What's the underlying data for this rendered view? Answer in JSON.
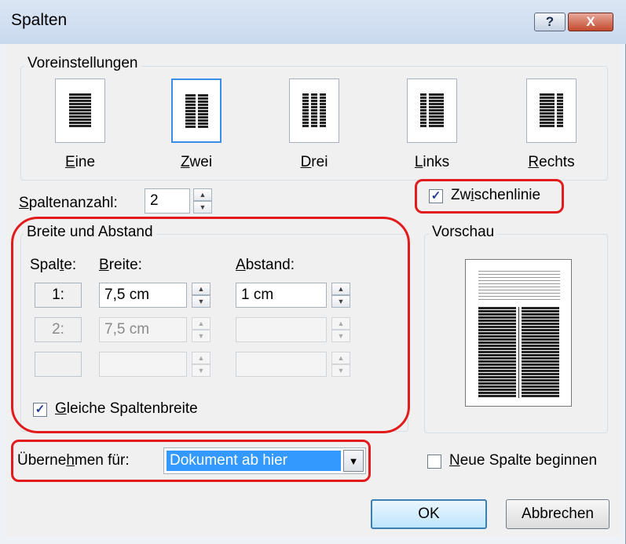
{
  "window": {
    "title": "Spalten",
    "help_label": "?",
    "close_label": "X"
  },
  "presets": {
    "group_title": "Voreinstellungen",
    "items": [
      {
        "label": "Eine",
        "accel": "E",
        "rest": "ine"
      },
      {
        "label": "Zwei",
        "accel": "Z",
        "rest": "wei"
      },
      {
        "label": "Drei",
        "accel": "D",
        "rest": "rei"
      },
      {
        "label": "Links",
        "accel": "L",
        "rest": "inks"
      },
      {
        "label": "Rechts",
        "accel": "R",
        "rest": "echts"
      }
    ],
    "selected": "Zwei"
  },
  "column_count": {
    "label_prefix": "S",
    "label_rest": "paltenanzahl:",
    "value": "2"
  },
  "separator_line": {
    "label_a": "Zw",
    "label_u": "i",
    "label_b": "schenlinie",
    "checked": true
  },
  "width_spacing": {
    "group_title": "Breite und Abstand",
    "col_header_a": "Spal",
    "col_header_u": "t",
    "col_header_b": "e:",
    "width_header_u": "B",
    "width_header_b": "reite:",
    "spacing_header_u": "A",
    "spacing_header_b": "bstand:",
    "rows": [
      {
        "col": "1:",
        "width": "7,5 cm",
        "spacing": "1 cm"
      },
      {
        "col": "2:",
        "width": "7,5 cm",
        "spacing": ""
      },
      {
        "col": "",
        "width": "",
        "spacing": ""
      }
    ],
    "equal_width_u": "G",
    "equal_width_rest": "leiche Spaltenbreite",
    "equal_width_checked": true
  },
  "preview": {
    "group_title": "Vorschau"
  },
  "apply_to": {
    "label_a": "Überne",
    "label_u": "h",
    "label_b": "men für:",
    "selected": "Dokument ab hier"
  },
  "new_column": {
    "label_u": "N",
    "label_rest": "eue Spalte beginnen",
    "checked": false
  },
  "buttons": {
    "ok": "OK",
    "cancel": "Abbrechen"
  },
  "colors": {
    "highlight_red": "#e21c1c",
    "selection_blue": "#3399ff",
    "preset_selected": "#3a8ee6"
  }
}
